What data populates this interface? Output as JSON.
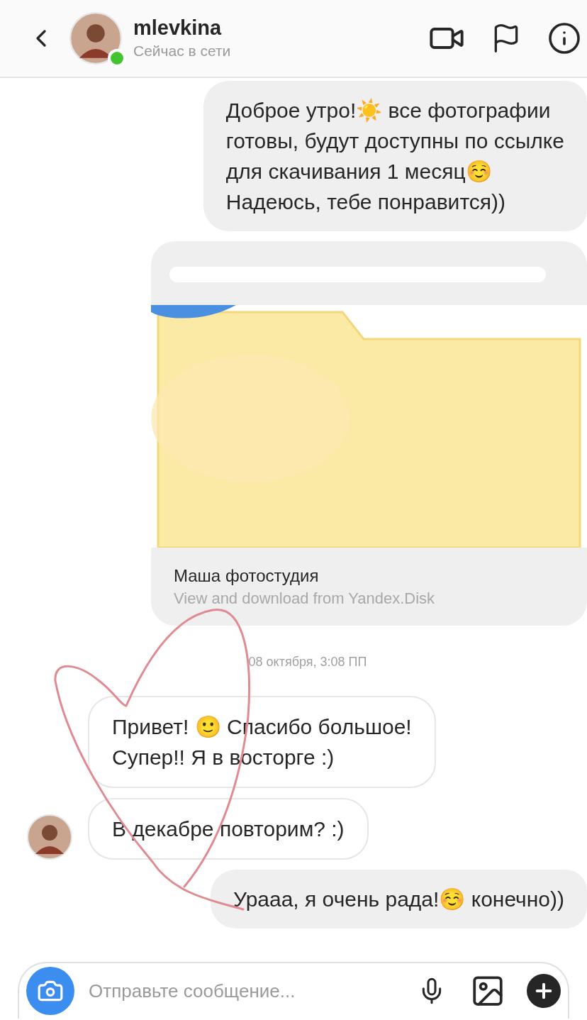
{
  "header": {
    "username": "mlevkina",
    "status": "Сейчас в сети",
    "online": true
  },
  "messages": [
    {
      "kind": "outgoing",
      "text": "Доброе утро!☀️ все фотографии\nготовы, будут доступны по ссылке\nдля скачивания 1 месяц☺️\nНадеюсь, тебе понравится))"
    },
    {
      "kind": "link",
      "redacted": true,
      "title": "Маша фотостудия",
      "subtitle": "View and download from Yandex.Disk"
    },
    {
      "kind": "time",
      "text": "08 октября, 3:08 ПП"
    },
    {
      "kind": "incoming",
      "avatar": false,
      "text": "Привет! 🙂 Спасибо большое!\nСупер!! Я в восторге :)"
    },
    {
      "kind": "incoming",
      "avatar": true,
      "text": "В декабре повторим? :)"
    },
    {
      "kind": "outgoing",
      "text": "Урааа, я очень рада!☺️ конечно))"
    }
  ],
  "composer": {
    "placeholder": "Отправьте сообщение..."
  }
}
